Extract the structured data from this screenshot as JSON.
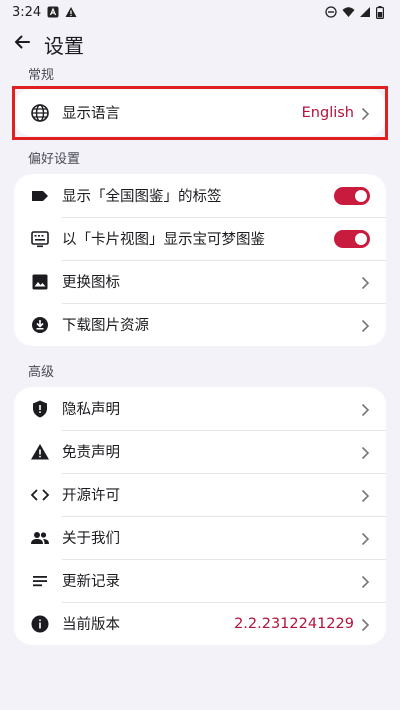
{
  "status": {
    "time": "3:24"
  },
  "topbar": {
    "title": "设置"
  },
  "sections": {
    "general": "常规",
    "preferences": "偏好设置",
    "advanced": "高级"
  },
  "general": {
    "language_label": "显示语言",
    "language_value": "English"
  },
  "preferences": {
    "items": [
      {
        "label": "显示「全国图鉴」的标签",
        "toggle_on": true
      },
      {
        "label": "以「卡片视图」显示宝可梦图鉴",
        "toggle_on": true
      },
      {
        "label": "更换图标"
      },
      {
        "label": "下载图片资源"
      }
    ]
  },
  "advanced": {
    "items": [
      {
        "label": "隐私声明"
      },
      {
        "label": "免责声明"
      },
      {
        "label": "开源许可"
      },
      {
        "label": "关于我们"
      },
      {
        "label": "更新记录"
      },
      {
        "label": "当前版本",
        "value": "2.2.2312241229"
      }
    ]
  },
  "colors": {
    "accent": "#b3123b",
    "toggle": "#c81b3e",
    "highlight": "#e02020",
    "background": "#f3f2f8"
  }
}
